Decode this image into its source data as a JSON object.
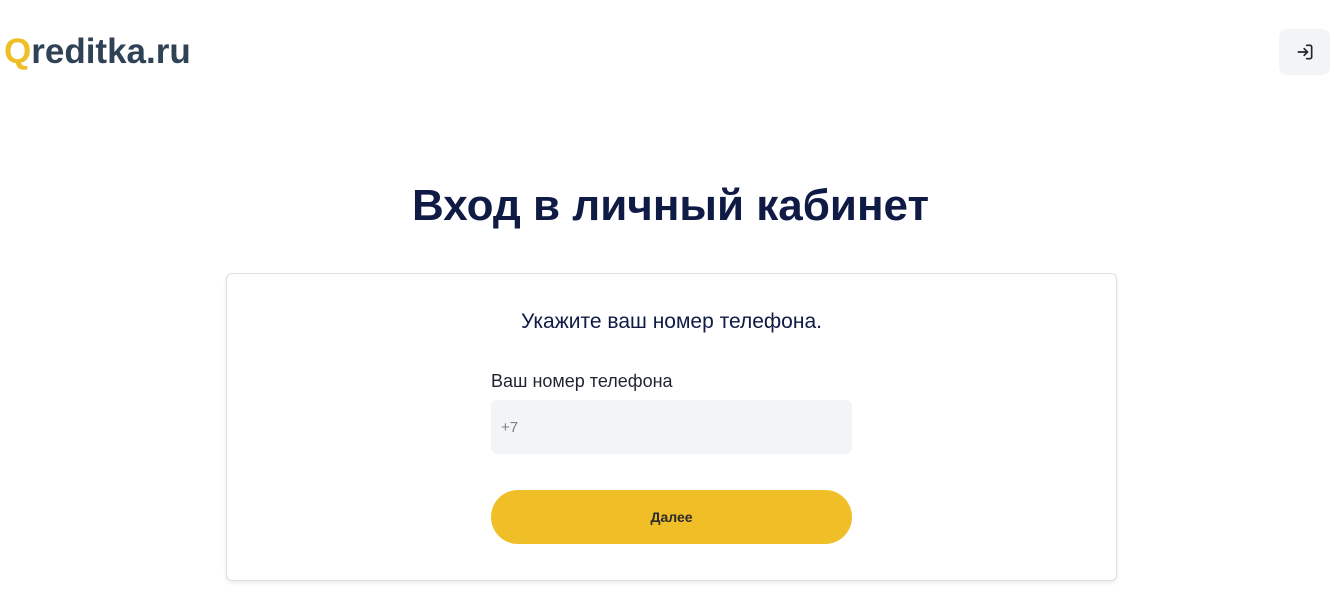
{
  "header": {
    "logo_first_letter": "Q",
    "logo_rest": "reditka.ru",
    "login_icon": "login-arrow-icon"
  },
  "main": {
    "title": "Вход в личный кабинет",
    "card": {
      "subtitle": "Укажите ваш номер телефона.",
      "phone_label": "Ваш номер телефона",
      "phone_placeholder": "+7",
      "phone_value": "",
      "next_button_label": "Далее"
    }
  },
  "colors": {
    "brand_yellow": "#f0bf27",
    "logo_text": "#2f4256",
    "title_navy": "#0f1a45",
    "input_bg": "#f3f4f6"
  }
}
